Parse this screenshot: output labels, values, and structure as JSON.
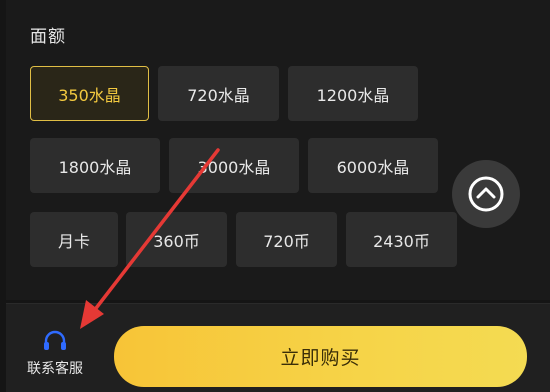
{
  "section": {
    "title": "面额"
  },
  "options": {
    "row1": [
      "350水晶",
      "720水晶",
      "1200水晶"
    ],
    "row2": [
      "1800水晶",
      "3000水晶",
      "6000水晶"
    ],
    "row3": [
      "月卡",
      "360币",
      "720币",
      "2430币"
    ],
    "selected": "350水晶"
  },
  "bottom_bar": {
    "support_label": "联系客服",
    "buy_label": "立即购买"
  },
  "colors": {
    "accent": "#f3c93f",
    "buy_button": "#f6d448",
    "annotation_arrow": "#e53935",
    "support_icon": "#2f6bff"
  },
  "icons": {
    "scroll_top": "chevron-up-circle-icon",
    "support": "headset-icon"
  }
}
